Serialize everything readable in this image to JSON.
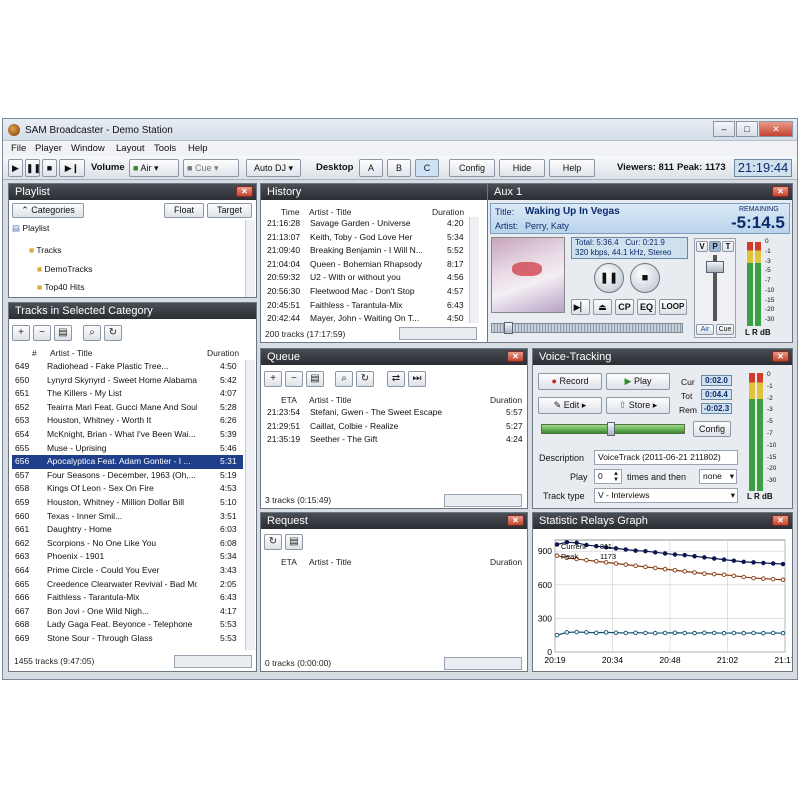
{
  "window": {
    "title": "SAM Broadcaster - Demo Station",
    "min": "–",
    "max": "□",
    "close": "✕"
  },
  "menu": [
    "File",
    "Player",
    "Window",
    "Layout",
    "Tools",
    "Help"
  ],
  "toolbar": {
    "volume_label": "Volume",
    "air_label": "Air",
    "cue_label": "Cue",
    "autodj_label": "Auto DJ",
    "desktop_label": "Desktop",
    "desk_a": "A",
    "desk_b": "B",
    "desk_c": "C",
    "config_label": "Config",
    "hide_label": "Hide",
    "help_label": "Help",
    "viewers": "Viewers: 811",
    "peak": "Peak: 1173",
    "clock": "21:19:44"
  },
  "playlist": {
    "title": "Playlist",
    "categories_label": "Categories",
    "float_label": "Float",
    "target_label": "Target",
    "tree": {
      "root": "Playlist",
      "items": [
        "Tracks",
        "DemoTracks",
        "Top40 Hits"
      ]
    }
  },
  "tracks": {
    "title": "Tracks in Selected Category",
    "col_num": "#",
    "col_title": "Artist - Title",
    "col_duration": "Duration",
    "rows": [
      {
        "n": "649",
        "t": "Radiohead - Fake Plastic Tree...",
        "d": "4:50"
      },
      {
        "n": "650",
        "t": "Lynyrd Skynyrd - Sweet Home Alabama",
        "d": "5:42"
      },
      {
        "n": "651",
        "t": "The Killers - My List",
        "d": "4:07"
      },
      {
        "n": "652",
        "t": "Teairra Mari Feat. Gucci Mane And Soul",
        "d": "5:28"
      },
      {
        "n": "653",
        "t": "Houston, Whitney - Worth It",
        "d": "6:26"
      },
      {
        "n": "654",
        "t": "McKnight, Brian - What I've Been Wai...",
        "d": "5:39"
      },
      {
        "n": "655",
        "t": "Muse - Uprising",
        "d": "5:46"
      },
      {
        "n": "656",
        "t": "Apocalyptica Feat. Adam Gontier - I ...",
        "d": "5:31"
      },
      {
        "n": "657",
        "t": "Four Seasons - December, 1963 (Oh,...",
        "d": "5:19"
      },
      {
        "n": "658",
        "t": "Kings Of Leon - Sex On Fire",
        "d": "4:53"
      },
      {
        "n": "659",
        "t": "Houston, Whitney - Million Dollar Bill",
        "d": "5:10"
      },
      {
        "n": "660",
        "t": "Texas - Inner Smil...",
        "d": "3:51"
      },
      {
        "n": "661",
        "t": "Daughtry - Home",
        "d": "6:03"
      },
      {
        "n": "662",
        "t": "Scorpions - No One Like You",
        "d": "6:08"
      },
      {
        "n": "663",
        "t": "Phoenix - 1901",
        "d": "5:34"
      },
      {
        "n": "664",
        "t": "Prime Circle - Could You Ever",
        "d": "3:43"
      },
      {
        "n": "665",
        "t": "Creedence Clearwater Revival - Bad Mo",
        "d": "2:05"
      },
      {
        "n": "666",
        "t": "Faithless - Tarantula-Mix",
        "d": "6:43"
      },
      {
        "n": "667",
        "t": "Bon Jovi - One Wild Nigh...",
        "d": "4:17"
      },
      {
        "n": "668",
        "t": "Lady Gaga Feat. Beyonce - Telephone",
        "d": "5:53"
      },
      {
        "n": "669",
        "t": "Stone Sour - Through Glass",
        "d": "5:53"
      }
    ],
    "selected_index": 7,
    "status": "1455 tracks (9:47:05)"
  },
  "history": {
    "title": "History",
    "col_time": "Time",
    "col_title": "Artist - Title",
    "col_duration": "Duration",
    "rows": [
      {
        "t": "21:16:28",
        "a": "Savage Garden - Universe",
        "d": "4:20"
      },
      {
        "t": "21:13:07",
        "a": "Keith, Toby - God Love Her",
        "d": "5:34"
      },
      {
        "t": "21:09:40",
        "a": "Breaking Benjamin - I Will N...",
        "d": "5:52"
      },
      {
        "t": "21:04:04",
        "a": "Queen - Bohemian Rhapsody",
        "d": "8:17"
      },
      {
        "t": "20:59:32",
        "a": "U2 - With or without you",
        "d": "4:56"
      },
      {
        "t": "20:56:30",
        "a": "Fleetwood Mac - Don't Stop",
        "d": "4:57"
      },
      {
        "t": "20:45:51",
        "a": "Faithless - Tarantula-Mix",
        "d": "6:43"
      },
      {
        "t": "20:42:44",
        "a": "Mayer, John - Waiting On T...",
        "d": "4:50"
      }
    ],
    "status": "200 tracks (17:17:59)"
  },
  "queue": {
    "title": "Queue",
    "col_eta": "ETA",
    "col_title": "Artist - Title",
    "col_duration": "Duration",
    "rows": [
      {
        "t": "21:23:54",
        "a": "Stefani, Gwen - The Sweet Escape",
        "d": "5:57"
      },
      {
        "t": "21:29:51",
        "a": "Caillat, Colbie - Realize",
        "d": "5:27"
      },
      {
        "t": "21:35:19",
        "a": "Seether - The Gift",
        "d": "4:24"
      }
    ],
    "status": "3 tracks (0:15:49)"
  },
  "request": {
    "title": "Request",
    "col_eta": "ETA",
    "col_title": "Artist - Title",
    "col_duration": "Duration",
    "status": "0 tracks (0:00:00)"
  },
  "aux": {
    "title": "Aux 1",
    "title_label": "Title:",
    "track_title": "Waking Up In Vegas",
    "artist_label": "Artist:",
    "artist": "Perry, Katy",
    "remaining_label": "REMAINING",
    "remaining": "-5:14.5",
    "total": "Total: 5:36.4",
    "cur": "Cur: 0:21.9",
    "format": "320 kbps, 44.1 kHz, Stereo",
    "cp": "CP",
    "eq": "EQ",
    "loop": "LOOP",
    "v": "V",
    "p": "P",
    "t": "T",
    "air": "Air",
    "cue": "Cue",
    "meter_label": "L R dB",
    "progress": 0.065,
    "scale": [
      "0",
      "-1",
      "-3",
      "-5",
      "-7",
      "-10",
      "-15",
      "-20",
      "-30"
    ]
  },
  "voice": {
    "title": "Voice-Tracking",
    "record": "Record",
    "play": "Play",
    "edit": "Edit",
    "store": "Store",
    "cur_label": "Cur",
    "cur": "0:02.0",
    "tot_label": "Tot",
    "tot": "0:04.4",
    "rem_label": "Rem",
    "rem": "-0:02.3",
    "config": "Config",
    "desc_label": "Description",
    "desc": "VoiceTrack (2011-06-21 211802)",
    "play_label": "Play",
    "play_count": "0",
    "times_then": "times and then",
    "then_value": "none",
    "track_type_label": "Track type",
    "track_type": "V - Interviews",
    "meter_label": "L R dB",
    "position": 0.48,
    "scale": [
      "0",
      "-1",
      "-2",
      "-3",
      "-5",
      "-7",
      "-10",
      "-15",
      "-20",
      "-30"
    ]
  },
  "graph": {
    "title": "Statistic Relays Graph"
  },
  "chart_data": {
    "type": "line",
    "x": [
      "20:19",
      "20:34",
      "20:48",
      "21:02",
      "21:17"
    ],
    "ylim": [
      0,
      1000
    ],
    "yticks": [
      0,
      300,
      600,
      900
    ],
    "legend": [
      {
        "name": "Current",
        "value": "811"
      },
      {
        "name": "Peak",
        "value": "1173"
      }
    ],
    "series": [
      {
        "name": "Peak",
        "color": "#0d1650",
        "values": [
          960,
          980,
          975,
          955,
          945,
          935,
          925,
          915,
          905,
          900,
          890,
          880,
          870,
          865,
          855,
          845,
          835,
          825,
          815,
          805,
          800,
          795,
          790,
          785
        ]
      },
      {
        "name": "Current",
        "color": "#8a3a10",
        "values": [
          860,
          840,
          830,
          820,
          810,
          800,
          790,
          780,
          770,
          760,
          750,
          740,
          730,
          720,
          710,
          700,
          695,
          690,
          680,
          670,
          660,
          655,
          650,
          645
        ]
      },
      {
        "name": "Relays",
        "color": "#0e4f6e",
        "values": [
          150,
          175,
          178,
          175,
          172,
          175,
          172,
          170,
          172,
          170,
          168,
          170,
          172,
          170,
          168,
          172,
          170,
          168,
          170,
          168,
          170,
          168,
          170,
          168
        ]
      }
    ]
  }
}
